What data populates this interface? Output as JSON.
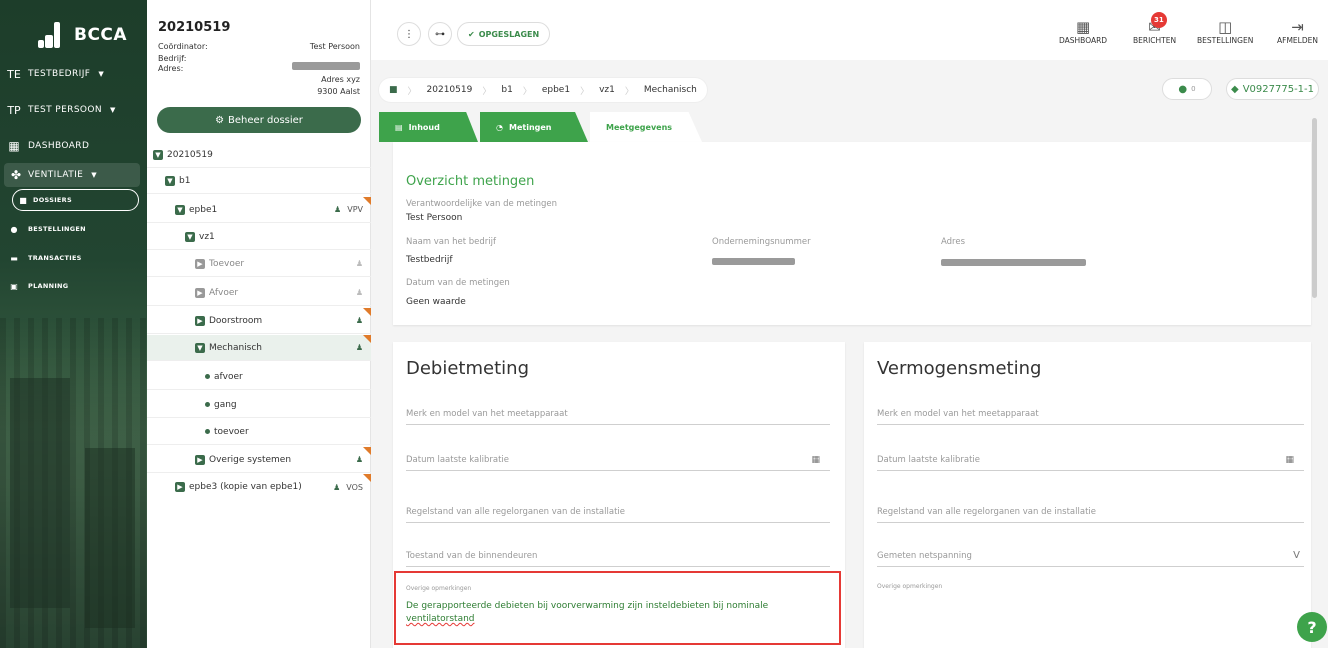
{
  "brand": {
    "name": "BCCA"
  },
  "sidebar": {
    "company": {
      "abbr": "TE",
      "label": "TESTBEDRIJF"
    },
    "person": {
      "abbr": "TP",
      "label": "TEST PERSOON"
    },
    "items": [
      {
        "label": "DASHBOARD"
      },
      {
        "label": "VENTILATIE"
      }
    ],
    "subitems": [
      {
        "label": "DOSSIERS"
      },
      {
        "label": "BESTELLINGEN"
      },
      {
        "label": "TRANSACTIES"
      },
      {
        "label": "PLANNING"
      }
    ]
  },
  "dossier": {
    "title": "20210519",
    "coordinator_label": "Coördinator:",
    "coordinator_value": "Test Persoon",
    "company_label": "Bedrijf:",
    "address_label": "Adres:",
    "address_line1": "Adres xyz",
    "address_line2": "9300 Aalst",
    "manage_button": "Beheer dossier"
  },
  "tree": [
    {
      "label": "20210519"
    },
    {
      "label": "b1"
    },
    {
      "label": "epbe1",
      "tag": "VPV"
    },
    {
      "label": "vz1"
    },
    {
      "label": "Toevoer"
    },
    {
      "label": "Afvoer"
    },
    {
      "label": "Doorstroom"
    },
    {
      "label": "Mechanisch"
    },
    {
      "label": "afvoer"
    },
    {
      "label": "gang"
    },
    {
      "label": "toevoer"
    },
    {
      "label": "Overige systemen"
    },
    {
      "label": "epbe3 (kopie van epbe1)",
      "tag": "VOS"
    }
  ],
  "topbar": {
    "saved_label": "OPGESLAGEN",
    "nav": [
      {
        "label": "DASHBOARD",
        "icon": "dashboard-icon"
      },
      {
        "label": "BERICHTEN",
        "icon": "mail-icon",
        "badge": "31"
      },
      {
        "label": "BESTELLINGEN",
        "icon": "wallet-icon"
      },
      {
        "label": "AFMELDEN",
        "icon": "logout-icon"
      }
    ]
  },
  "breadcrumb": [
    "20210519",
    "b1",
    "epbe1",
    "vz1",
    "Mechanisch"
  ],
  "comment_count": "0",
  "tag_label": "V0927775-1-1",
  "tabs": [
    {
      "label": "Inhoud"
    },
    {
      "label": "Metingen"
    },
    {
      "label": "Meetgegevens"
    }
  ],
  "overview": {
    "title": "Overzicht metingen",
    "responsible_label": "Verantwoordelijke van de metingen",
    "responsible_value": "Test Persoon",
    "company_label": "Naam van het bedrijf",
    "company_value": "Testbedrijf",
    "enterprise_label": "Ondernemingsnummer",
    "address_label": "Adres",
    "date_label": "Datum van de metingen",
    "date_value": "Geen waarde"
  },
  "debiet": {
    "title": "Debietmeting",
    "f1": "Merk en model van het meetapparaat",
    "f2": "Datum laatste kalibratie",
    "f3": "Regelstand van alle regelorganen van de installatie",
    "f4": "Toestand van de binnendeuren",
    "remarks_label": "Overige opmerkingen",
    "remarks_text_1": "De gerapporteerde debieten bij voorverwarming zijn insteldebieten bij nominale",
    "remarks_text_2": "ventilatorstand"
  },
  "vermogen": {
    "title": "Vermogensmeting",
    "f1": "Merk en model van het meetapparaat",
    "f2": "Datum laatste kalibratie",
    "f3": "Regelstand van alle regelorganen van de installatie",
    "f4": "Gemeten netspanning",
    "f4_unit": "V",
    "remarks_label": "Overige opmerkingen"
  },
  "help_label": "?"
}
